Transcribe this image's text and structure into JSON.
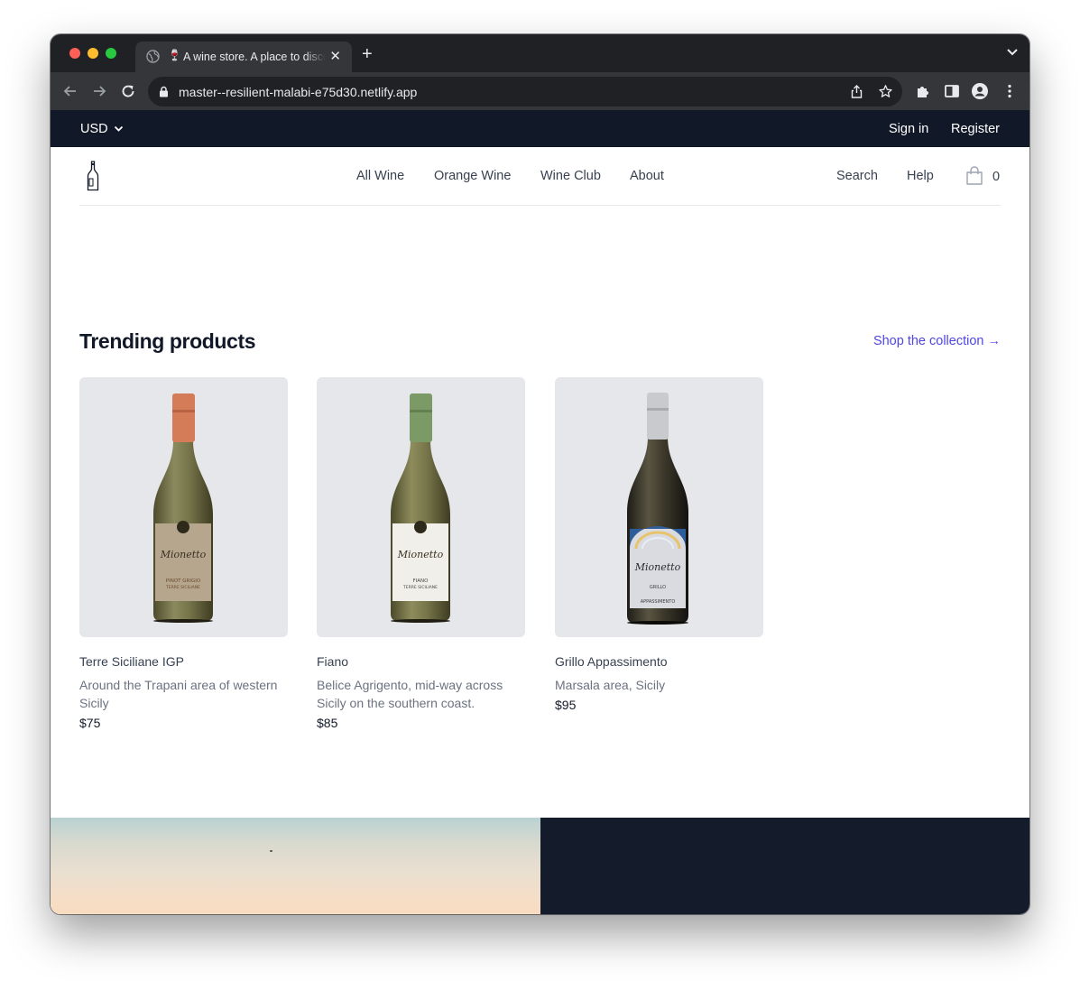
{
  "browser": {
    "tab_title": "A wine store. A place to discover",
    "tab_favicon": "🍷",
    "url": "master--resilient-malabi-e75d30.netlify.app",
    "icons": [
      "globe-icon",
      "close-icon",
      "plus-icon",
      "chevron-down-icon",
      "back-icon",
      "forward-icon",
      "reload-icon",
      "lock-icon",
      "share-icon",
      "star-icon",
      "extensions-icon",
      "sidepanel-icon",
      "profile-icon",
      "menu-icon"
    ]
  },
  "topbar": {
    "currency": "USD",
    "signin": "Sign in",
    "register": "Register"
  },
  "header": {
    "nav": [
      "All Wine",
      "Orange Wine",
      "Wine Club",
      "About"
    ],
    "search": "Search",
    "help": "Help",
    "cart_count": "0"
  },
  "trending": {
    "title": "Trending products",
    "shop_link": "Shop the collection →",
    "products": [
      {
        "name": "Terre Siciliane IGP",
        "desc": "Around the Trapani area of western Sicily",
        "price": "$75",
        "label": "PINOT GRIGIO",
        "label2": "TERRE SICILIANE"
      },
      {
        "name": "Fiano",
        "desc": "Belice Agrigento, mid-way across Sicily on the southern coast.",
        "price": "$85",
        "label": "FIANO",
        "label2": "TERRE SICILIANE"
      },
      {
        "name": "Grillo Appassimento",
        "desc": "Marsala area, Sicily",
        "price": "$95",
        "label": "GRILLO",
        "label2": "APPASSIMENTO"
      }
    ]
  },
  "colors": {
    "topbar_bg": "#111827",
    "link_accent": "#4f46e5",
    "card_bg": "#e6e7eb",
    "banner_dark": "#141b2b"
  }
}
